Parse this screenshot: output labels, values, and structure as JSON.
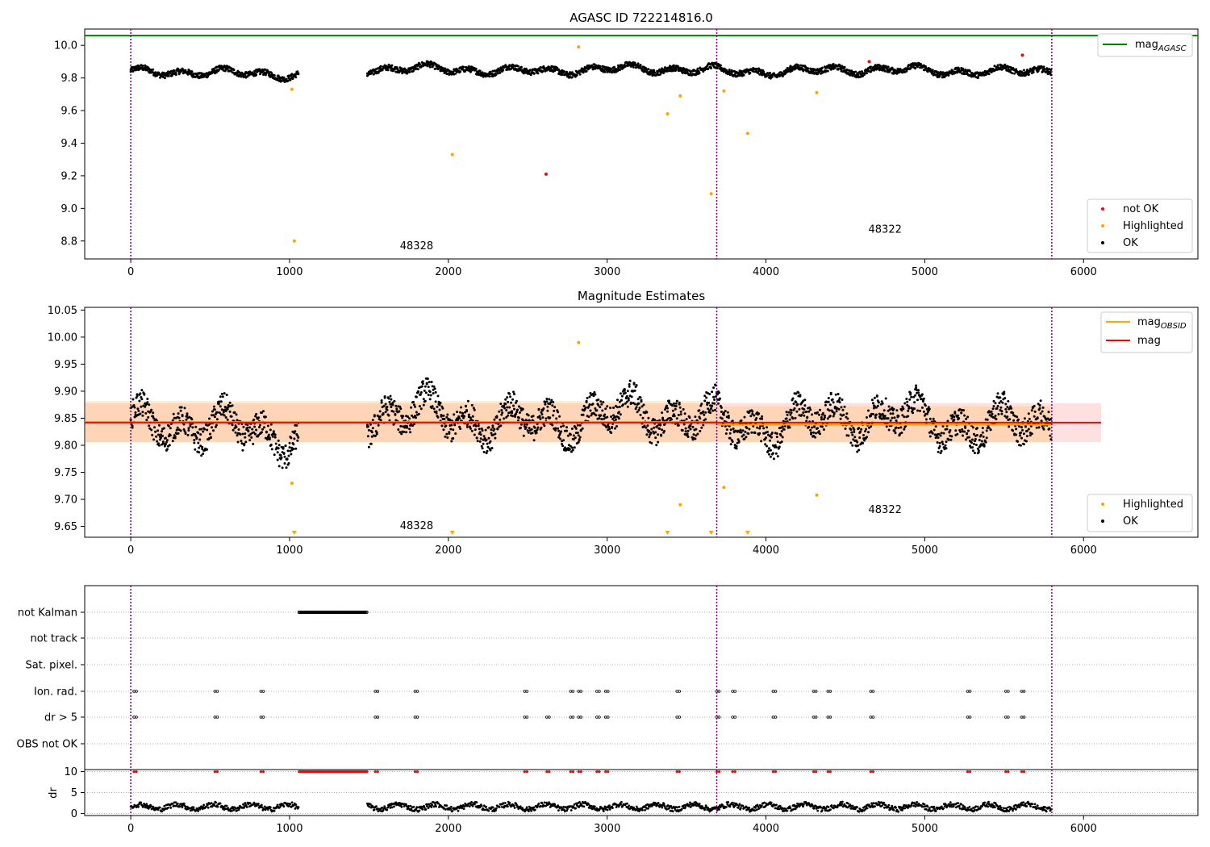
{
  "chart_data": [
    {
      "type": "scatter",
      "title": "AGASC ID 722214816.0",
      "xlim": [
        -290,
        6720
      ],
      "ylim": [
        8.69,
        10.1
      ],
      "xticks": [
        0,
        1000,
        2000,
        3000,
        4000,
        5000,
        6000
      ],
      "yticks": [
        8.8,
        9.0,
        9.2,
        9.4,
        9.6,
        9.8,
        10.0
      ],
      "ytick_labels": [
        "8.8",
        "9.0",
        "9.2",
        "9.4",
        "9.6",
        "9.8",
        "10.0"
      ],
      "obsid_boundaries": [
        0,
        3690,
        5800
      ],
      "obsid_labels": [
        {
          "text": "48328",
          "x": 1800,
          "y": 8.75
        },
        {
          "text": "48322",
          "x": 4750,
          "y": 8.85
        }
      ],
      "reference_line": {
        "name": "mag",
        "subscript": "AGASC",
        "y": 10.06,
        "color": "#008000"
      },
      "legend_top": [
        {
          "name": "mag",
          "subscript": "AGASC",
          "color": "#008000",
          "kind": "line"
        }
      ],
      "legend_bottom": [
        {
          "name": "not OK",
          "color": "#ff0000",
          "kind": "dot"
        },
        {
          "name": "Highlighted",
          "color": "#ffa500",
          "kind": "dot"
        },
        {
          "name": "OK",
          "color": "#000000",
          "kind": "dot"
        }
      ],
      "ok_segments": [
        {
          "x0": 0,
          "x1": 1060,
          "mean": 9.83
        },
        {
          "x0": 1490,
          "x1": 3690,
          "mean": 9.85
        },
        {
          "x0": 3690,
          "x1": 5800,
          "mean": 9.845
        }
      ],
      "highlighted_points": [
        [
          1015,
          9.73
        ],
        [
          1030,
          8.8
        ],
        [
          2025,
          9.33
        ],
        [
          2820,
          9.99
        ],
        [
          3380,
          9.58
        ],
        [
          3460,
          9.69
        ],
        [
          3655,
          9.09
        ],
        [
          3735,
          9.72
        ],
        [
          3885,
          9.46
        ],
        [
          4320,
          9.71
        ]
      ],
      "not_ok_points": [
        [
          2615,
          9.21
        ],
        [
          4650,
          9.9
        ],
        [
          5615,
          9.94
        ]
      ]
    },
    {
      "type": "scatter",
      "title": "Magnitude Estimates",
      "xlim": [
        -290,
        6720
      ],
      "ylim": [
        9.63,
        10.055
      ],
      "xticks": [
        0,
        1000,
        2000,
        3000,
        4000,
        5000,
        6000
      ],
      "yticks": [
        9.65,
        9.7,
        9.75,
        9.8,
        9.85,
        9.9,
        9.95,
        10.0,
        10.05
      ],
      "ytick_labels": [
        "9.65",
        "9.70",
        "9.75",
        "9.80",
        "9.85",
        "9.90",
        "9.95",
        "10.00",
        "10.05"
      ],
      "obsid_boundaries": [
        0,
        3690,
        5800
      ],
      "obsid_labels": [
        {
          "text": "48328",
          "x": 1800,
          "y": 9.645
        },
        {
          "text": "48322",
          "x": 4750,
          "y": 9.675
        }
      ],
      "mag_line": {
        "y": 9.842,
        "x0": -290,
        "x1": 6110,
        "band": [
          9.806,
          9.878
        ],
        "color": "#ff0000"
      },
      "obsid_mag": [
        {
          "x0": -290,
          "x1": 3690,
          "y": 9.843,
          "band": [
            9.805,
            9.882
          ]
        },
        {
          "x0": 3690,
          "x1": 5800,
          "y": 9.838,
          "band": [
            9.805,
            9.872
          ]
        }
      ],
      "legend_top": [
        {
          "name": "mag",
          "subscript": "OBSID",
          "color": "#ffa500",
          "kind": "line"
        },
        {
          "name": "mag",
          "subscript": "",
          "color": "#ff0000",
          "kind": "line"
        }
      ],
      "legend_bottom": [
        {
          "name": "Highlighted",
          "color": "#ffa500",
          "kind": "dot"
        },
        {
          "name": "OK",
          "color": "#000000",
          "kind": "dot"
        }
      ],
      "highlighted_points": [
        [
          1015,
          9.73
        ],
        [
          2820,
          9.99
        ],
        [
          3460,
          9.69
        ],
        [
          3735,
          9.722
        ],
        [
          4320,
          9.708
        ]
      ],
      "clipped_points": [
        1030,
        2025,
        3380,
        3655,
        3885
      ]
    },
    {
      "type": "scatter",
      "title": "",
      "xlim": [
        -290,
        6720
      ],
      "xticks": [
        0,
        1000,
        2000,
        3000,
        4000,
        5000,
        6000
      ],
      "obsid_boundaries": [
        0,
        3690,
        5800
      ],
      "flag_rows": [
        "not Kalman",
        "not track",
        "Sat. pixel.",
        "Ion. rad.",
        "dr > 5",
        "OBS not OK"
      ],
      "not_kalman_range": [
        1060,
        1490
      ],
      "ion_rad_x": [
        20,
        530,
        820,
        1540,
        1790,
        2480,
        2770,
        2820,
        2935,
        2990,
        3440,
        3690,
        3790,
        4045,
        4300,
        4390,
        4660,
        5270,
        5510,
        5610
      ],
      "dr_gt_5_x": [
        20,
        530,
        820,
        1540,
        1790,
        2480,
        2620,
        2770,
        2820,
        2935,
        2990,
        3440,
        3690,
        3790,
        4045,
        4300,
        4390,
        4660,
        5270,
        5510,
        5610
      ],
      "dr_ylabel": "dr",
      "dr_ylim": [
        -0.5,
        10.5
      ],
      "dr_yticks": [
        0,
        5,
        10
      ],
      "dr_ytick_labels": [
        "0",
        "5",
        "10"
      ],
      "dr_typical": 1.6
    }
  ]
}
